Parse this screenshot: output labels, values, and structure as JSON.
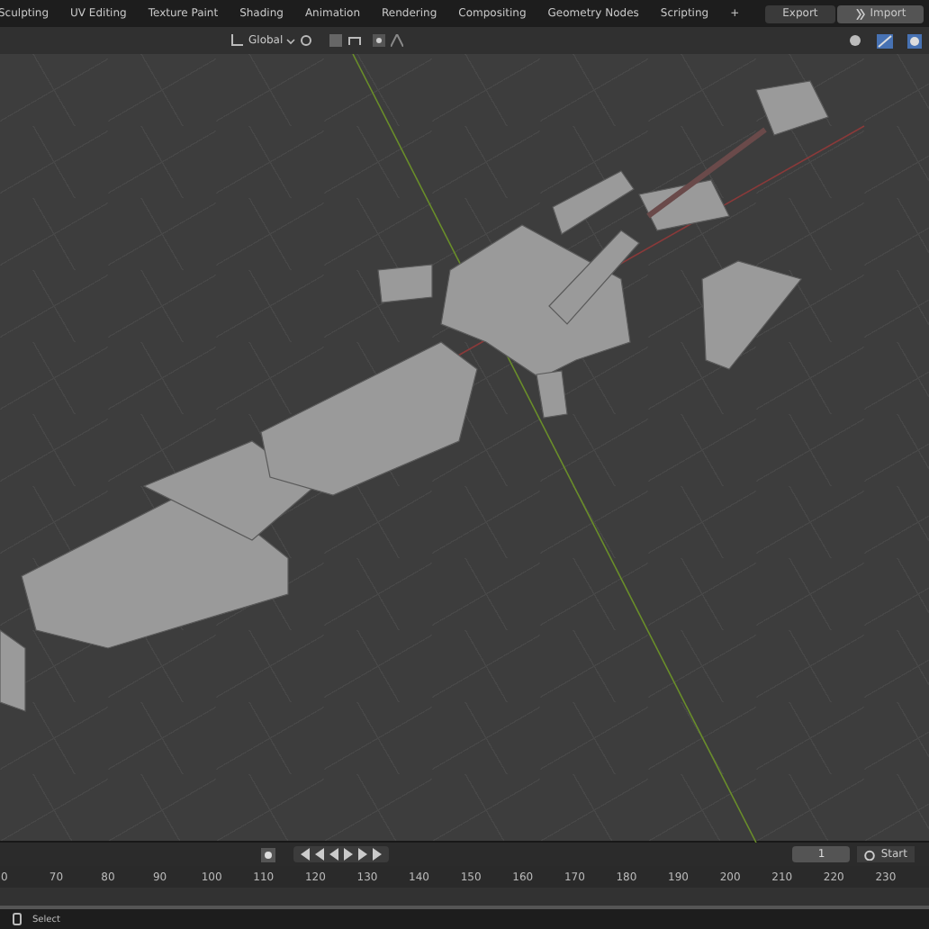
{
  "workspace_tabs": [
    "Sculpting",
    "UV Editing",
    "Texture Paint",
    "Shading",
    "Animation",
    "Rendering",
    "Compositing",
    "Geometry Nodes",
    "Scripting"
  ],
  "add_tab": "+",
  "header_buttons": [
    {
      "label": "Export",
      "kind": "plain"
    },
    {
      "label": "Import",
      "kind": "icon"
    }
  ],
  "viewport_header": {
    "orientation": "Global"
  },
  "timeline": {
    "current_frame": "1",
    "start_label": "Start",
    "ruler": [
      "0",
      "70",
      "80",
      "90",
      "100",
      "110",
      "120",
      "130",
      "140",
      "150",
      "160",
      "170",
      "180",
      "190",
      "200",
      "210",
      "220",
      "230"
    ]
  },
  "status_bar": {
    "text": "Select"
  }
}
